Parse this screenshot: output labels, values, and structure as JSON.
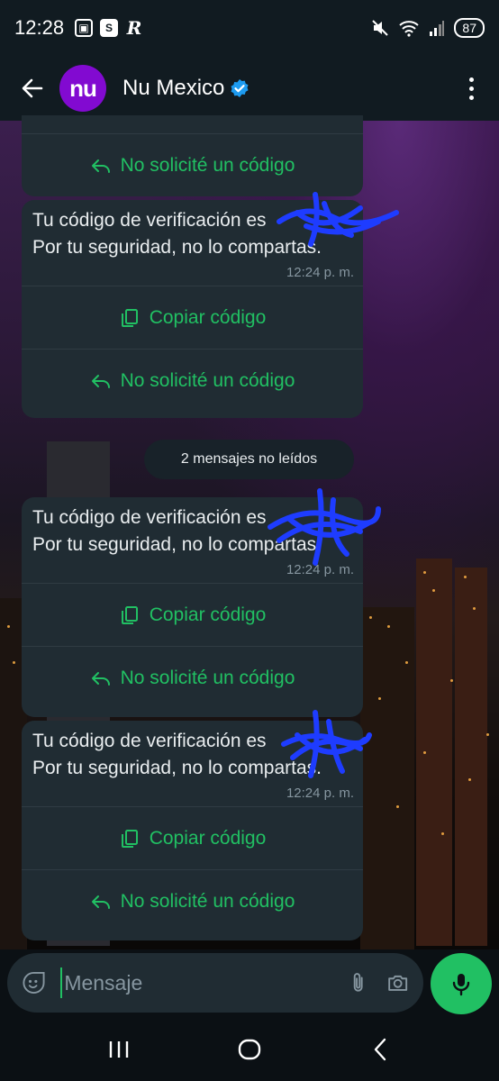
{
  "status_bar": {
    "time": "12:28",
    "left_icons": [
      "screenshot-icon",
      "s-app-icon",
      "r-app-icon"
    ],
    "right_icons": [
      "mute-vibrate-icon",
      "wifi-6-icon",
      "signal-icon"
    ],
    "battery": "87"
  },
  "header": {
    "contact_name": "Nu Mexico",
    "avatar_text": "nu",
    "avatar_color": "#820ad1",
    "verified": true
  },
  "colors": {
    "accent": "#21c063",
    "bubble": "#202c33",
    "header_bg": "#111b21",
    "scribble": "#1e3cff"
  },
  "messages": [
    {
      "partial": true,
      "actions": [
        {
          "icon": "reply-icon",
          "label": "No solicité un código"
        }
      ]
    },
    {
      "text_line1": "Tu código de verificación es",
      "text_line2": "Por tu seguridad, no lo compartas.",
      "time": "12:24 p. m.",
      "actions": [
        {
          "icon": "copy-icon",
          "label": "Copiar código"
        },
        {
          "icon": "reply-icon",
          "label": "No solicité un código"
        }
      ]
    },
    {
      "text_line1": "Tu código de verificación es",
      "text_line2": "Por tu seguridad, no lo compartas.",
      "time": "12:24 p. m.",
      "actions": [
        {
          "icon": "copy-icon",
          "label": "Copiar código"
        },
        {
          "icon": "reply-icon",
          "label": "No solicité un código"
        }
      ]
    },
    {
      "text_line1": "Tu código de verificación es",
      "text_line2": "Por tu seguridad, no lo compartas.",
      "time": "12:24 p. m.",
      "actions": [
        {
          "icon": "copy-icon",
          "label": "Copiar código"
        },
        {
          "icon": "reply-icon",
          "label": "No solicité un código"
        }
      ]
    }
  ],
  "unread_divider": "2 mensajes no leídos",
  "composer": {
    "placeholder": "Mensaje",
    "icons": [
      "emoji-sticker-icon",
      "paperclip-icon",
      "camera-icon",
      "microphone-icon"
    ]
  },
  "nav_bar": {
    "buttons": [
      "recents-icon",
      "home-icon",
      "back-nav-icon"
    ]
  }
}
